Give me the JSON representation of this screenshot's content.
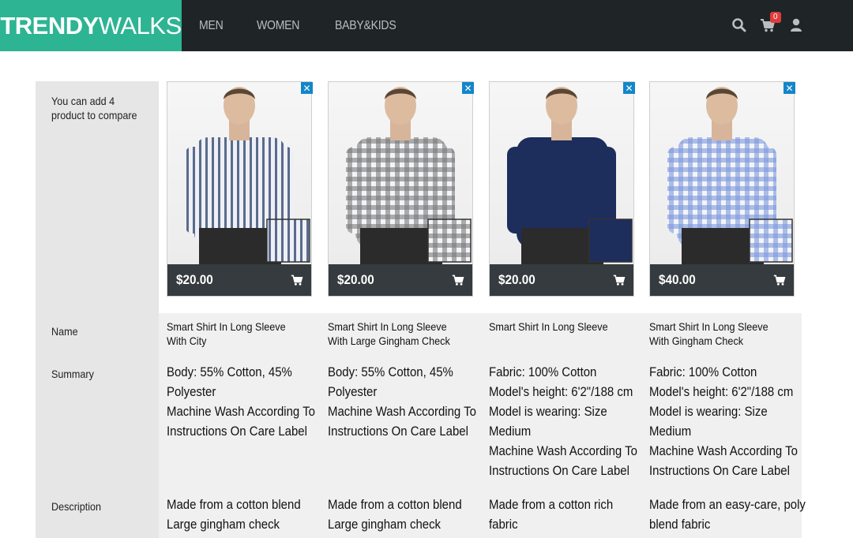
{
  "brand": {
    "bold": "TRENDY",
    "light": "WALKS"
  },
  "nav": [
    "MEN",
    "WOMEN",
    "BABY&KIDS"
  ],
  "header_icons": {
    "search": "search-icon",
    "cart": "cart-icon",
    "user": "user-icon",
    "cart_count": "0"
  },
  "compare": {
    "intro": "You can add 4 product to compare",
    "row_labels": {
      "name": "Name",
      "summary": "Summary",
      "description": "Description"
    },
    "products": [
      {
        "price": "$20.00",
        "name": "Smart Shirt In Long Sleeve With City",
        "summary": [
          "Body: 55% Cotton, 45%",
          "Polyester",
          "Machine Wash According To",
          "Instructions On Care Label"
        ],
        "description": [
          "Made from a cotton blend",
          "Large gingham check"
        ],
        "shirt_color": "#cdd3df",
        "stripe": "#5a6b8c",
        "pattern": "stripe"
      },
      {
        "price": "$20.00",
        "name": "Smart Shirt In Long Sleeve With Large Gingham Check",
        "summary": [
          "Body: 55% Cotton, 45%",
          "Polyester",
          "Machine Wash According To",
          "Instructions On Care Label"
        ],
        "description": [
          "Made from a cotton blend",
          "Large gingham check"
        ],
        "shirt_color": "#d6d6d6",
        "stripe": "#7a7a7a",
        "pattern": "check"
      },
      {
        "price": "$20.00",
        "name": "Smart Shirt In Long Sleeve",
        "summary": [
          "Fabric: 100% Cotton",
          "Model's height: 6'2\"/188 cm",
          "Model is wearing: Size",
          "Medium",
          "Machine Wash According To",
          "Instructions On Care Label"
        ],
        "description": [
          "Made from a cotton rich",
          "fabric"
        ],
        "shirt_color": "#1d2d5c",
        "stripe": "#1d2d5c",
        "pattern": "solid"
      },
      {
        "price": "$40.00",
        "name": "Smart Shirt In Long Sleeve With Gingham Check",
        "summary": [
          "Fabric: 100% Cotton",
          "Model's height: 6'2\"/188 cm",
          "Model is wearing: Size",
          "Medium",
          "Machine Wash According To",
          "Instructions On Care Label"
        ],
        "description": [
          "Made from an easy-care, poly",
          "blend fabric"
        ],
        "shirt_color": "#b7c8ee",
        "stripe": "#7d97dc",
        "pattern": "check"
      }
    ]
  },
  "colors": {
    "brand": "#2db493",
    "header": "#1f2426",
    "price_bar": "#353b3e",
    "close": "#1386c9",
    "badge": "#e03c3c"
  }
}
